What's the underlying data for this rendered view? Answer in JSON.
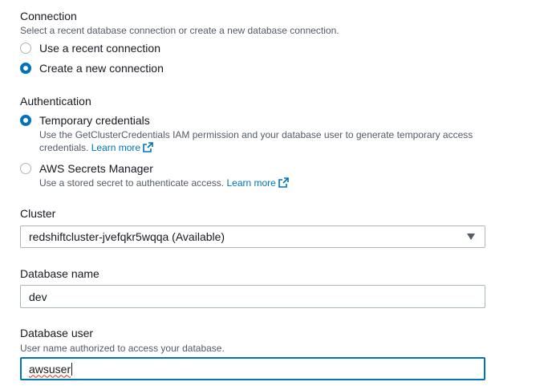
{
  "connection": {
    "label": "Connection",
    "description": "Select a recent database connection or create a new database connection.",
    "options": [
      {
        "label": "Use a recent connection",
        "checked": false
      },
      {
        "label": "Create a new connection",
        "checked": true
      }
    ]
  },
  "authentication": {
    "label": "Authentication",
    "options": [
      {
        "label": "Temporary credentials",
        "checked": true,
        "description": "Use the GetClusterCredentials IAM permission and your database user to generate temporary access credentials.",
        "link": "Learn more"
      },
      {
        "label": "AWS Secrets Manager",
        "checked": false,
        "description": "Use a stored secret to authenticate access.",
        "link": "Learn more"
      }
    ]
  },
  "cluster": {
    "label": "Cluster",
    "selected": "redshiftcluster-jvefqkr5wqqa (Available)"
  },
  "database_name": {
    "label": "Database name",
    "value": "dev"
  },
  "database_user": {
    "label": "Database user",
    "description": "User name authorized to access your database.",
    "value": "awsuser"
  },
  "colors": {
    "accent": "#0073bb",
    "text": "#16191f",
    "muted": "#545b64",
    "border": "#aab7b8"
  }
}
